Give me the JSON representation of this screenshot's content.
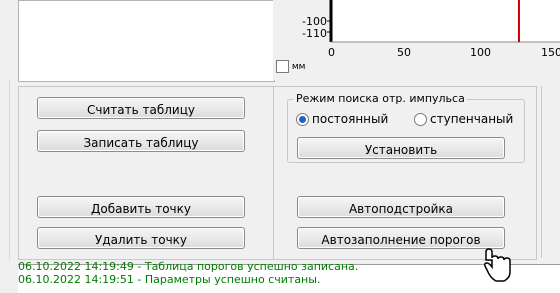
{
  "chart_data": {
    "type": "line",
    "y_ticks": [
      "-100",
      "-110"
    ],
    "x_ticks": [
      "0",
      "50",
      "100",
      "150"
    ],
    "marker_x": 127
  },
  "units_checkbox": {
    "label": "мм"
  },
  "buttons": {
    "read_table": "Считать таблицу",
    "write_table": "Записать таблицу",
    "add_point": "Добавить точку",
    "delete_point": "Удалить точку",
    "set": "Установить",
    "autotune": "Автоподстройка",
    "autofill": "Автозаполнение порогов"
  },
  "pulse_mode": {
    "title": "Режим поиска отр. импульса",
    "options": [
      "постоянный",
      "ступенчаный"
    ],
    "selected": "постоянный"
  },
  "log": {
    "lines": [
      "06.10.2022 14:19:49 - Таблица порогов успешно записана.",
      "06.10.2022 14:19:51 - Параметры успешно считаны."
    ]
  },
  "colors": {
    "marker": "#cc0000",
    "log_text": "#007a00",
    "radio_selected": "#1e5fc8"
  }
}
